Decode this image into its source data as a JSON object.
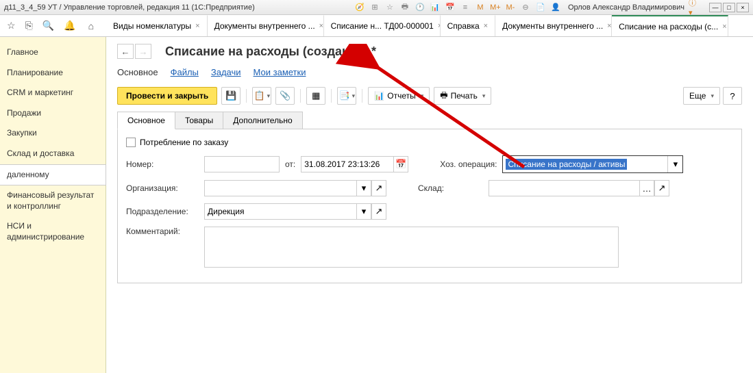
{
  "titlebar": {
    "text": "д11_3_4_59 УТ / Управление торговлей, редакция 11  (1С:Предприятие)",
    "user": "Орлов Александр Владимирович",
    "m_labels": [
      "M",
      "M+",
      "M-"
    ]
  },
  "tabs": [
    {
      "label": "Виды номенклатуры",
      "closable": true
    },
    {
      "label": "Документы внутреннего ...",
      "closable": true
    },
    {
      "label": "Списание н... ТД00-000001",
      "closable": true
    },
    {
      "label": "Справка",
      "closable": true
    },
    {
      "label": "Документы внутреннего ...",
      "closable": true
    },
    {
      "label": "Списание на расходы (с...",
      "closable": true,
      "active": true
    }
  ],
  "sidebar": {
    "items": [
      {
        "label": "Главное"
      },
      {
        "label": "Планирование"
      },
      {
        "label": "CRM и маркетинг"
      },
      {
        "label": "Продажи"
      },
      {
        "label": "Закупки"
      },
      {
        "label": "Склад и доставка"
      },
      {
        "label": "даленному",
        "active": true
      },
      {
        "label": "Финансовый результат и контроллинг"
      },
      {
        "label": "НСИ и администрирование"
      }
    ]
  },
  "page": {
    "title": "Списание на расходы (создание) *",
    "links": [
      "Основное",
      "Файлы",
      "Задачи",
      "Мои заметки"
    ],
    "toolbar": {
      "submit": "Провести и закрыть",
      "reports": "Отчеты",
      "print": "Печать",
      "more": "Еще"
    },
    "subtabs": [
      "Основное",
      "Товары",
      "Дополнительно"
    ],
    "form": {
      "consume_by_order_label": "Потребление по заказу",
      "number_label": "Номер:",
      "number_value": "",
      "from_label": "от:",
      "date_value": "31.08.2017 23:13:26",
      "operation_label": "Хоз. операция:",
      "operation_value": "Списание на расходы / активы",
      "org_label": "Организация:",
      "org_value": "",
      "warehouse_label": "Склад:",
      "warehouse_value": "",
      "dept_label": "Подразделение:",
      "dept_value": "Дирекция",
      "comment_label": "Комментарий:",
      "comment_value": ""
    }
  }
}
